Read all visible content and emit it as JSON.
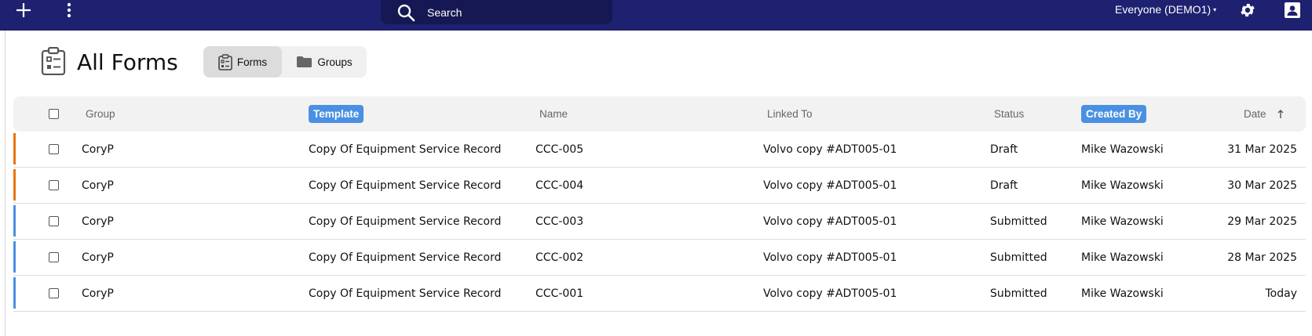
{
  "topbar": {
    "search_label": "Search",
    "account_label": "Everyone (DEMO1)"
  },
  "page": {
    "title": "All Forms",
    "toggle": [
      {
        "label": "Forms",
        "icon": "clipboard-icon",
        "active": true
      },
      {
        "label": "Groups",
        "icon": "folder-icon",
        "active": false
      }
    ]
  },
  "table": {
    "columns": {
      "group": "Group",
      "template": "Template",
      "name": "Name",
      "linked_to": "Linked To",
      "status": "Status",
      "created_by": "Created By",
      "date": "Date"
    },
    "rows": [
      {
        "group": "CoryP",
        "template": "Copy Of Equipment Service Record",
        "name": "CCC-005",
        "linked_to": "Volvo copy #ADT005-01",
        "status": "Draft",
        "created_by": "Mike Wazowski",
        "date": "31 Mar 2025",
        "bar_color": "#e8750f"
      },
      {
        "group": "CoryP",
        "template": "Copy Of Equipment Service Record",
        "name": "CCC-004",
        "linked_to": "Volvo copy #ADT005-01",
        "status": "Draft",
        "created_by": "Mike Wazowski",
        "date": "30 Mar 2025",
        "bar_color": "#e8750f"
      },
      {
        "group": "CoryP",
        "template": "Copy Of Equipment Service Record",
        "name": "CCC-003",
        "linked_to": "Volvo copy #ADT005-01",
        "status": "Submitted",
        "created_by": "Mike Wazowski",
        "date": "29 Mar 2025",
        "bar_color": "#4a90e2"
      },
      {
        "group": "CoryP",
        "template": "Copy Of Equipment Service Record",
        "name": "CCC-002",
        "linked_to": "Volvo copy #ADT005-01",
        "status": "Submitted",
        "created_by": "Mike Wazowski",
        "date": "28 Mar 2025",
        "bar_color": "#4a90e2"
      },
      {
        "group": "CoryP",
        "template": "Copy Of Equipment Service Record",
        "name": "CCC-001",
        "linked_to": "Volvo copy #ADT005-01",
        "status": "Submitted",
        "created_by": "Mike Wazowski",
        "date": "Today",
        "bar_color": "#4a90e2"
      }
    ]
  },
  "colors": {
    "topbar": "#1e2170",
    "search_bg": "#151852",
    "accent": "#4a90e2",
    "draft": "#e8750f",
    "submitted": "#4a90e2"
  }
}
